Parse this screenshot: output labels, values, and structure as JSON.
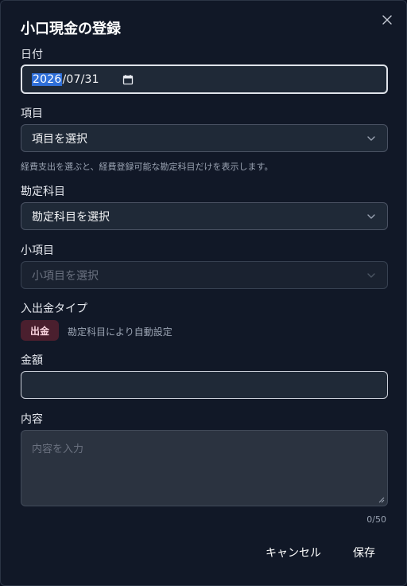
{
  "dialog": {
    "title": "小口現金の登録",
    "close_glyph": "×"
  },
  "date": {
    "label": "日付",
    "value_year": "2026",
    "value_rest": "/07/31"
  },
  "item": {
    "label": "項目",
    "placeholder": "項目を選択",
    "help": "経費支出を選ぶと、経費登録可能な勘定科目だけを表示します。"
  },
  "account": {
    "label": "勘定科目",
    "placeholder": "勘定科目を選択"
  },
  "subitem": {
    "label": "小項目",
    "placeholder": "小項目を選択"
  },
  "type": {
    "label": "入出金タイプ",
    "badge": "出金",
    "note": "勘定科目により自動設定"
  },
  "amount": {
    "label": "金額",
    "value": ""
  },
  "content": {
    "label": "内容",
    "placeholder": "内容を入力",
    "counter": "0/50"
  },
  "actions": {
    "cancel": "キャンセル",
    "save": "保存"
  },
  "colors": {
    "background": "#111827",
    "field": "#1f2937",
    "badge_bg": "#4a1f2e",
    "focus_border": "#dfe3ea"
  }
}
